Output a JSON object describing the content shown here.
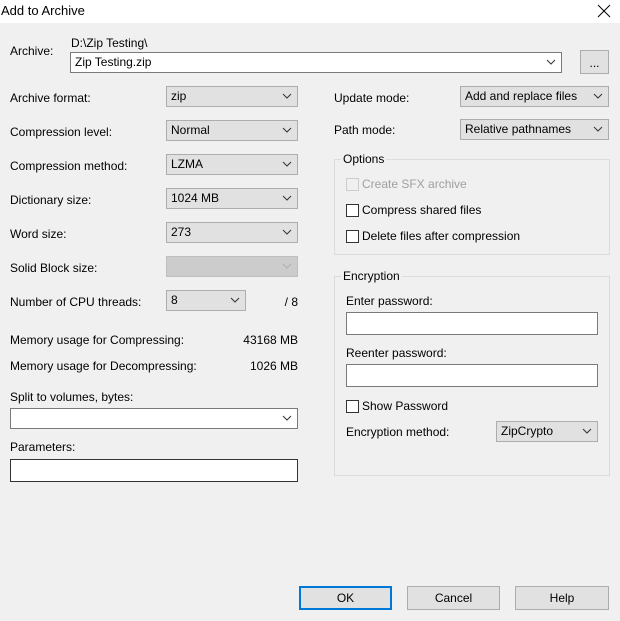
{
  "window": {
    "title": "Add to Archive",
    "close_icon": "close-icon"
  },
  "archive": {
    "label": "Archive:",
    "path": "D:\\Zip Testing\\",
    "filename": "Zip Testing.zip",
    "browse_label": "..."
  },
  "left": {
    "archive_format": {
      "label": "Archive format:",
      "value": "zip"
    },
    "compression_level": {
      "label": "Compression level:",
      "value": "Normal"
    },
    "compression_method": {
      "label": "Compression method:",
      "value": "LZMA"
    },
    "dictionary_size": {
      "label": "Dictionary size:",
      "value": "1024 MB"
    },
    "word_size": {
      "label": "Word size:",
      "value": "273"
    },
    "solid_block_size": {
      "label": "Solid Block size:",
      "value": ""
    },
    "cpu_threads": {
      "label": "Number of CPU threads:",
      "value": "8",
      "max": "/ 8"
    },
    "mem_compress": {
      "label": "Memory usage for Compressing:",
      "value": "43168 MB"
    },
    "mem_decompress": {
      "label": "Memory usage for Decompressing:",
      "value": "1026 MB"
    },
    "split": {
      "label": "Split to volumes, bytes:",
      "value": ""
    },
    "parameters": {
      "label": "Parameters:",
      "value": ""
    }
  },
  "right": {
    "update_mode": {
      "label": "Update mode:",
      "value": "Add and replace files"
    },
    "path_mode": {
      "label": "Path mode:",
      "value": "Relative pathnames"
    },
    "options": {
      "title": "Options",
      "create_sfx": {
        "label": "Create SFX archive",
        "checked": false,
        "disabled": true
      },
      "compress_shared": {
        "label": "Compress shared files",
        "checked": false
      },
      "delete_after": {
        "label": "Delete files after compression",
        "checked": false
      }
    },
    "encryption": {
      "title": "Encryption",
      "enter_password_label": "Enter password:",
      "enter_password_value": "",
      "reenter_password_label": "Reenter password:",
      "reenter_password_value": "",
      "show_password": {
        "label": "Show Password",
        "checked": false
      },
      "method_label": "Encryption method:",
      "method_value": "ZipCrypto"
    }
  },
  "buttons": {
    "ok": "OK",
    "cancel": "Cancel",
    "help": "Help"
  }
}
